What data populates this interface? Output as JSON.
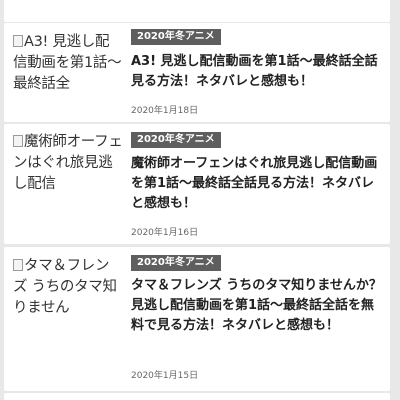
{
  "articles": [
    {
      "thumb_alt": "A3! 見逃し配信動画を第1話〜最終話全",
      "category": "2020年冬アニメ",
      "title": "A3! 見逃し配信動画を第1話〜最終話全話見る方法！ネタバレと感想も！",
      "date": "2020年1月18日"
    },
    {
      "thumb_alt": "魔術師オーフェンはぐれ旅見逃し配信",
      "category": "2020年冬アニメ",
      "title": "魔術師オーフェンはぐれ旅見逃し配信動画を第1話〜最終話全話見る方法！ネタバレと感想も！",
      "date": "2020年1月16日"
    },
    {
      "thumb_alt": "タマ＆フレンズ うちのタマ知りません",
      "category": "2020年冬アニメ",
      "title": "タマ＆フレンズ うちのタマ知りませんか？見逃し配信動画を第1話〜最終話全話を無料で見る方法！ネタバレと感想も！",
      "date": "2020年1月15日"
    }
  ],
  "icons": {
    "broken_image": "broken-image-icon"
  },
  "colors": {
    "page_background": "#e8e8e8",
    "card_background": "#ffffff",
    "category_badge": "#5e5e5e",
    "title_text": "#222222",
    "date_text": "#666666"
  }
}
